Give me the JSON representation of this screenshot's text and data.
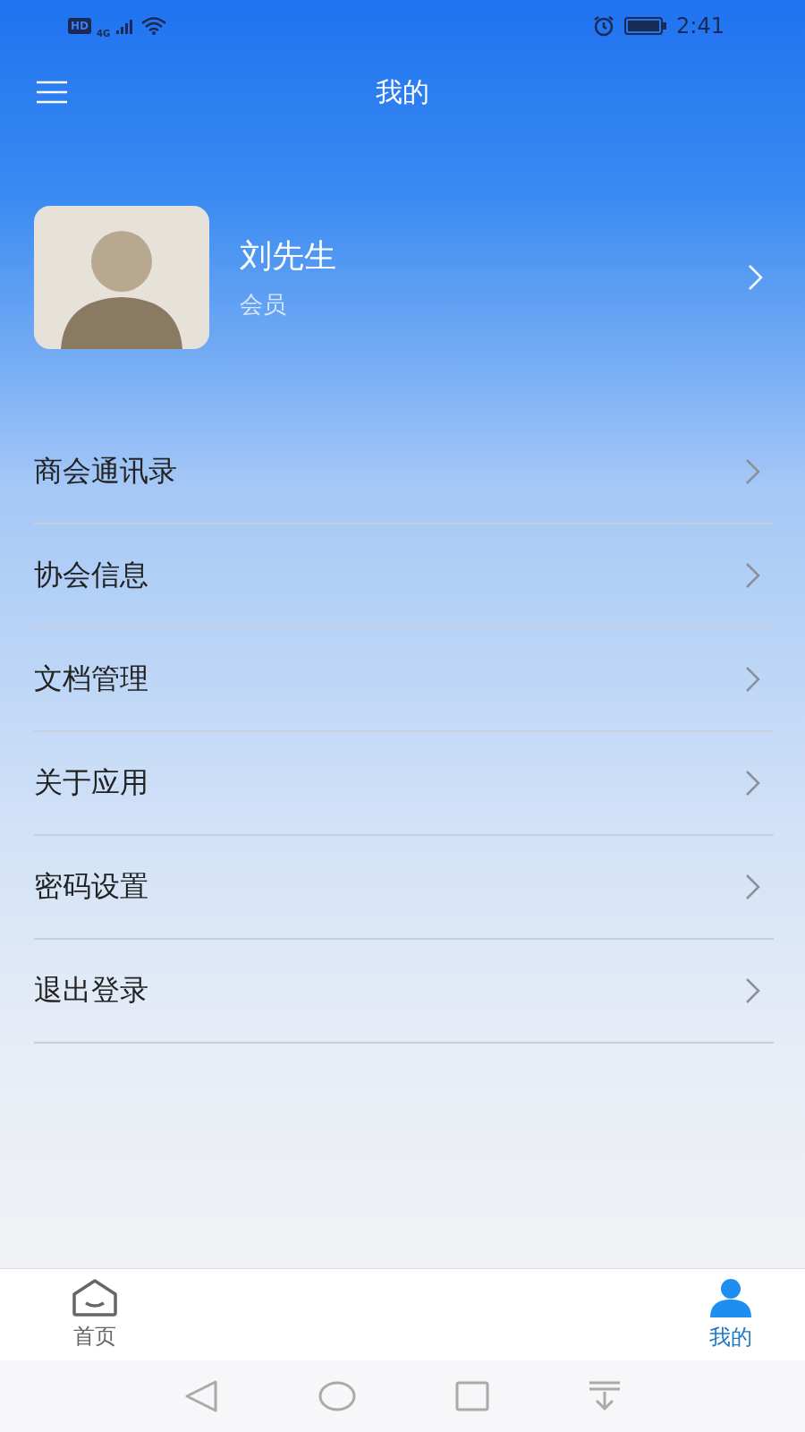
{
  "status_bar": {
    "hd": "HD",
    "network": "4G",
    "time": "2:41"
  },
  "header": {
    "title": "我的"
  },
  "profile": {
    "name": "刘先生",
    "role": "会员"
  },
  "menu": [
    {
      "label": "商会通讯录"
    },
    {
      "label": "协会信息"
    },
    {
      "label": "文档管理"
    },
    {
      "label": "关于应用"
    },
    {
      "label": "密码设置"
    },
    {
      "label": "退出登录"
    }
  ],
  "tabs": [
    {
      "label": "首页",
      "kind": "home",
      "selected": false
    },
    {
      "label": "我的",
      "kind": "user",
      "selected": true
    }
  ]
}
